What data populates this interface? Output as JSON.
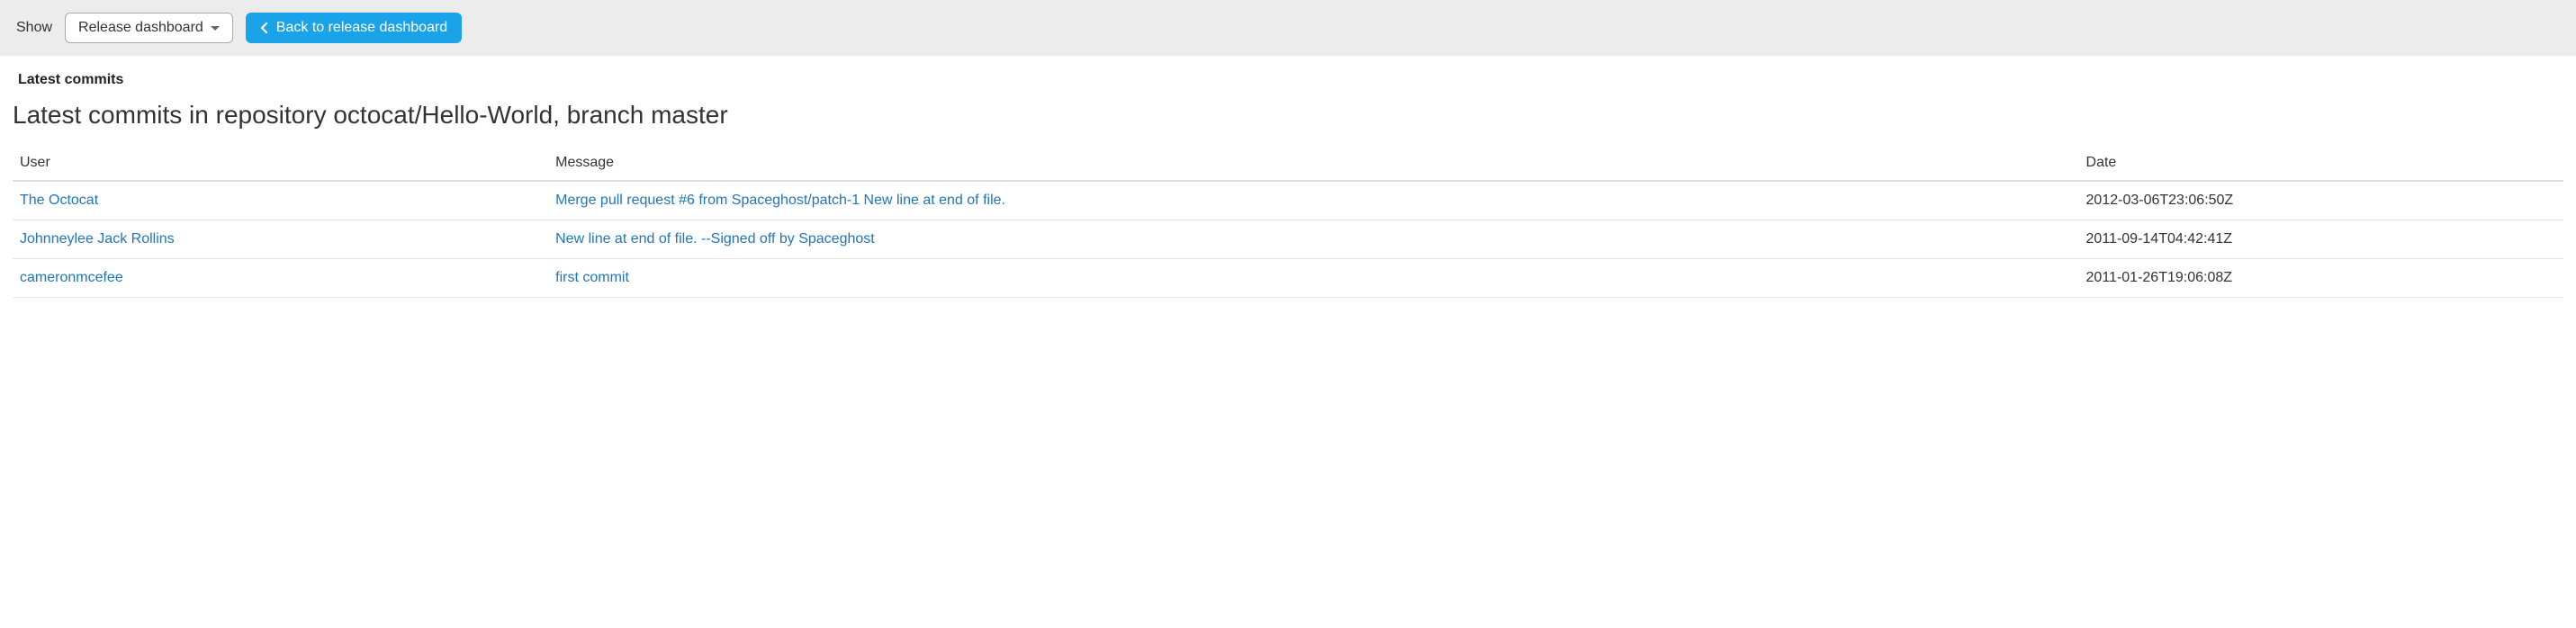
{
  "toolbar": {
    "show_label": "Show",
    "dropdown_value": "Release dashboard",
    "back_button_label": "Back to release dashboard"
  },
  "tab_title": "Latest commits",
  "heading": "Latest commits in repository octocat/Hello-World, branch master",
  "table": {
    "headers": {
      "user": "User",
      "message": "Message",
      "date": "Date"
    },
    "rows": [
      {
        "user": "The Octocat",
        "message": "Merge pull request #6 from Spaceghost/patch-1 New line at end of file.",
        "date": "2012-03-06T23:06:50Z"
      },
      {
        "user": "Johnneylee Jack Rollins",
        "message": "New line at end of file. --Signed off by Spaceghost",
        "date": "2011-09-14T04:42:41Z"
      },
      {
        "user": "cameronmcefee",
        "message": "first commit",
        "date": "2011-01-26T19:06:08Z"
      }
    ]
  }
}
